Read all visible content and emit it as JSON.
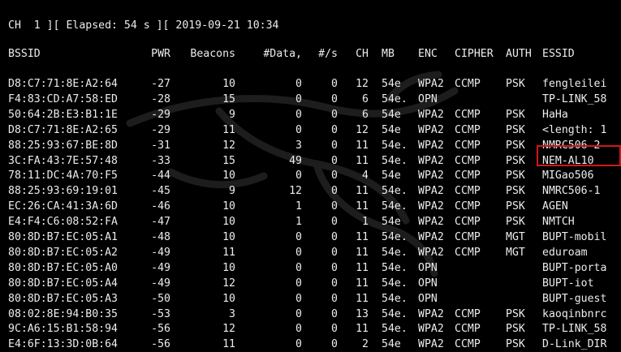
{
  "status": {
    "text": "CH  1 ][ Elapsed: 54 s ][ 2019-09-21 10:34"
  },
  "columns": {
    "bssid": "BSSID",
    "pwr": "PWR",
    "beacons": "Beacons",
    "data": "#Data,",
    "rate": "#/s",
    "ch": "CH",
    "mb": "MB",
    "enc": "ENC",
    "cipher": "CIPHER",
    "auth": "AUTH",
    "essid": "ESSID"
  },
  "rows": [
    {
      "bssid": "D8:C7:71:8E:A2:64",
      "pwr": "-27",
      "beacons": "10",
      "data": "0",
      "rate": "0",
      "ch": "12",
      "mb": "54e",
      "enc": "WPA2",
      "cipher": "CCMP",
      "auth": "PSK",
      "essid": "fengleilei"
    },
    {
      "bssid": "F4:83:CD:A7:58:ED",
      "pwr": "-28",
      "beacons": "15",
      "data": "0",
      "rate": "0",
      "ch": "6",
      "mb": "54e.",
      "enc": "OPN",
      "cipher": "",
      "auth": "",
      "essid": "TP-LINK_58"
    },
    {
      "bssid": "50:64:2B:E3:B1:1E",
      "pwr": "-29",
      "beacons": "9",
      "data": "0",
      "rate": "0",
      "ch": "6",
      "mb": "54e",
      "enc": "WPA2",
      "cipher": "CCMP",
      "auth": "PSK",
      "essid": "HaHa"
    },
    {
      "bssid": "D8:C7:71:8E:A2:65",
      "pwr": "-29",
      "beacons": "11",
      "data": "0",
      "rate": "0",
      "ch": "12",
      "mb": "54e",
      "enc": "WPA2",
      "cipher": "CCMP",
      "auth": "PSK",
      "essid": "<length: 1"
    },
    {
      "bssid": "88:25:93:67:BE:8D",
      "pwr": "-31",
      "beacons": "12",
      "data": "3",
      "rate": "0",
      "ch": "11",
      "mb": "54e.",
      "enc": "WPA2",
      "cipher": "CCMP",
      "auth": "PSK",
      "essid": "NMRC506-2"
    },
    {
      "bssid": "3C:FA:43:7E:57:48",
      "pwr": "-33",
      "beacons": "15",
      "data": "49",
      "rate": "0",
      "ch": "11",
      "mb": "54e.",
      "enc": "WPA2",
      "cipher": "CCMP",
      "auth": "PSK",
      "essid": "NEM-AL10"
    },
    {
      "bssid": "78:11:DC:4A:70:F5",
      "pwr": "-44",
      "beacons": "10",
      "data": "0",
      "rate": "0",
      "ch": "4",
      "mb": "54e",
      "enc": "WPA2",
      "cipher": "CCMP",
      "auth": "PSK",
      "essid": "MIGao506"
    },
    {
      "bssid": "88:25:93:69:19:01",
      "pwr": "-45",
      "beacons": "9",
      "data": "12",
      "rate": "0",
      "ch": "11",
      "mb": "54e.",
      "enc": "WPA2",
      "cipher": "CCMP",
      "auth": "PSK",
      "essid": "NMRC506-1"
    },
    {
      "bssid": "EC:26:CA:41:3A:6D",
      "pwr": "-46",
      "beacons": "10",
      "data": "1",
      "rate": "0",
      "ch": "11",
      "mb": "54e.",
      "enc": "WPA2",
      "cipher": "CCMP",
      "auth": "PSK",
      "essid": "AGEN"
    },
    {
      "bssid": "E4:F4:C6:08:52:FA",
      "pwr": "-47",
      "beacons": "10",
      "data": "1",
      "rate": "0",
      "ch": "1",
      "mb": "54e",
      "enc": "WPA2",
      "cipher": "CCMP",
      "auth": "PSK",
      "essid": "NMTCH"
    },
    {
      "bssid": "80:8D:B7:EC:05:A1",
      "pwr": "-48",
      "beacons": "10",
      "data": "0",
      "rate": "0",
      "ch": "11",
      "mb": "54e.",
      "enc": "WPA2",
      "cipher": "CCMP",
      "auth": "MGT",
      "essid": "BUPT-mobil"
    },
    {
      "bssid": "80:8D:B7:EC:05:A2",
      "pwr": "-49",
      "beacons": "11",
      "data": "0",
      "rate": "0",
      "ch": "11",
      "mb": "54e.",
      "enc": "WPA2",
      "cipher": "CCMP",
      "auth": "MGT",
      "essid": "eduroam"
    },
    {
      "bssid": "80:8D:B7:EC:05:A0",
      "pwr": "-49",
      "beacons": "10",
      "data": "0",
      "rate": "0",
      "ch": "11",
      "mb": "54e.",
      "enc": "OPN",
      "cipher": "",
      "auth": "",
      "essid": "BUPT-porta"
    },
    {
      "bssid": "80:8D:B7:EC:05:A4",
      "pwr": "-49",
      "beacons": "12",
      "data": "0",
      "rate": "0",
      "ch": "11",
      "mb": "54e.",
      "enc": "OPN",
      "cipher": "",
      "auth": "",
      "essid": "BUPT-iot"
    },
    {
      "bssid": "80:8D:B7:EC:05:A3",
      "pwr": "-50",
      "beacons": "10",
      "data": "0",
      "rate": "0",
      "ch": "11",
      "mb": "54e.",
      "enc": "OPN",
      "cipher": "",
      "auth": "",
      "essid": "BUPT-guest"
    },
    {
      "bssid": "08:02:8E:94:B0:35",
      "pwr": "-53",
      "beacons": "3",
      "data": "0",
      "rate": "0",
      "ch": "13",
      "mb": "54e.",
      "enc": "WPA2",
      "cipher": "CCMP",
      "auth": "PSK",
      "essid": "kaoqinbnrc"
    },
    {
      "bssid": "9C:A6:15:B1:58:94",
      "pwr": "-56",
      "beacons": "12",
      "data": "0",
      "rate": "0",
      "ch": "11",
      "mb": "54e.",
      "enc": "WPA2",
      "cipher": "CCMP",
      "auth": "PSK",
      "essid": "TP-LINK_58"
    },
    {
      "bssid": "E4:6F:13:3D:0B:64",
      "pwr": "-56",
      "beacons": "11",
      "data": "0",
      "rate": "0",
      "ch": "2",
      "mb": "54e",
      "enc": "WPA2",
      "cipher": "CCMP",
      "auth": "PSK",
      "essid": "D-Link_DIR"
    }
  ],
  "highlight": {
    "color": "#d01818",
    "target_essid": "NEM-AL10"
  },
  "colors": {
    "background": "#000000",
    "text": "#ececec"
  }
}
